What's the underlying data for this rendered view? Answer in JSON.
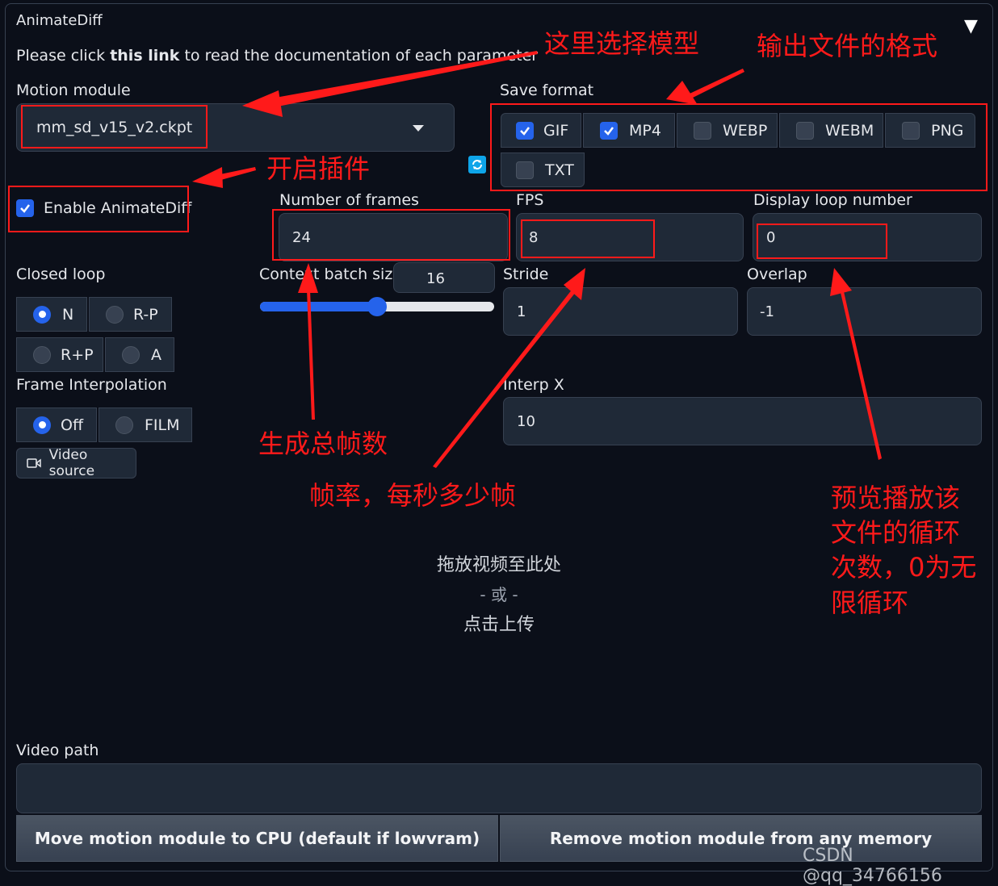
{
  "panel": {
    "title": "AnimateDiff",
    "collapse_glyph": "▼",
    "doc_text_pre": "Please click ",
    "doc_link": "this link",
    "doc_text_post": " to read the documentation of each parameter"
  },
  "motion_module": {
    "label": "Motion module",
    "value": "mm_sd_v15_v2.ckpt",
    "refresh_icon": "refresh-icon"
  },
  "enable": {
    "label": "Enable AnimateDiff",
    "checked": true
  },
  "save_format": {
    "label": "Save format",
    "options": [
      {
        "label": "GIF",
        "checked": true
      },
      {
        "label": "MP4",
        "checked": true
      },
      {
        "label": "WEBP",
        "checked": false
      },
      {
        "label": "WEBM",
        "checked": false
      },
      {
        "label": "PNG",
        "checked": false
      },
      {
        "label": "TXT",
        "checked": false
      }
    ]
  },
  "frames": {
    "label": "Number of frames",
    "value": "24"
  },
  "fps": {
    "label": "FPS",
    "value": "8"
  },
  "loop": {
    "label": "Display loop number",
    "value": "0"
  },
  "closed_loop": {
    "label": "Closed loop",
    "options": [
      "N",
      "R-P",
      "R+P",
      "A"
    ],
    "selected": "N"
  },
  "context": {
    "label": "Context batch size",
    "value": "16",
    "slider_fraction": 0.5
  },
  "stride": {
    "label": "Stride",
    "value": "1"
  },
  "overlap": {
    "label": "Overlap",
    "value": "-1"
  },
  "interp": {
    "label": "Frame Interpolation",
    "options": [
      "Off",
      "FILM"
    ],
    "selected": "Off"
  },
  "interp_x": {
    "label": "Interp X",
    "value": "10"
  },
  "video_source": {
    "label": "Video source",
    "icon": "video-camera-icon"
  },
  "upload": {
    "line1": "拖放视频至此处",
    "line2": "- 或 -",
    "line3": "点击上传"
  },
  "video_path": {
    "label": "Video path",
    "value": ""
  },
  "buttons": {
    "cpu": "Move motion module to CPU (default if lowvram)",
    "remove": "Remove motion module from any memory"
  },
  "annotations": {
    "model": "这里选择模型",
    "format": "输出文件的格式",
    "plugin": "开启插件",
    "frames": "生成总帧数",
    "fps": "帧率，每秒多少帧",
    "loop": [
      "预览播放该",
      "文件的循环",
      "次数，0为无",
      "限循环"
    ]
  },
  "watermark": "CSDN @qq_34766156",
  "colors": {
    "accent": "#2563eb",
    "annotation": "#ff1a1a",
    "background": "#0b0f19",
    "field": "#1f2937"
  }
}
